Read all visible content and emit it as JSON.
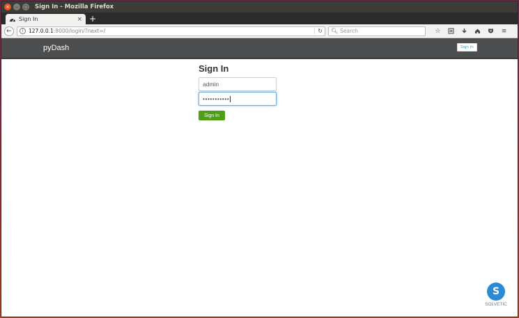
{
  "window": {
    "title": "Sign In - Mozilla Firefox",
    "buttons": {
      "close": "×",
      "min": "–",
      "max": "□"
    }
  },
  "tab": {
    "label": "Sign In",
    "close": "×",
    "new_tab": "+"
  },
  "nav": {
    "url_host": "127.0.0.1",
    "url_path": ":8000/login/?next=/",
    "search_placeholder": "Search",
    "icons": [
      "bookmark-star-icon",
      "reading-list-icon",
      "download-icon",
      "home-icon",
      "pocket-icon",
      "menu-icon"
    ]
  },
  "site": {
    "brand": "pyDash",
    "header_signin": "Sign In"
  },
  "form": {
    "title": "Sign In",
    "username_value": "admin",
    "password_masked": "•••••••••••",
    "submit_label": "Sign In"
  },
  "watermark": {
    "letter": "S",
    "text": "SOLVETIC"
  },
  "colors": {
    "accent_green": "#4f9e1a",
    "header_bg": "#4b4d4f",
    "focus_blue": "#66afe9"
  }
}
